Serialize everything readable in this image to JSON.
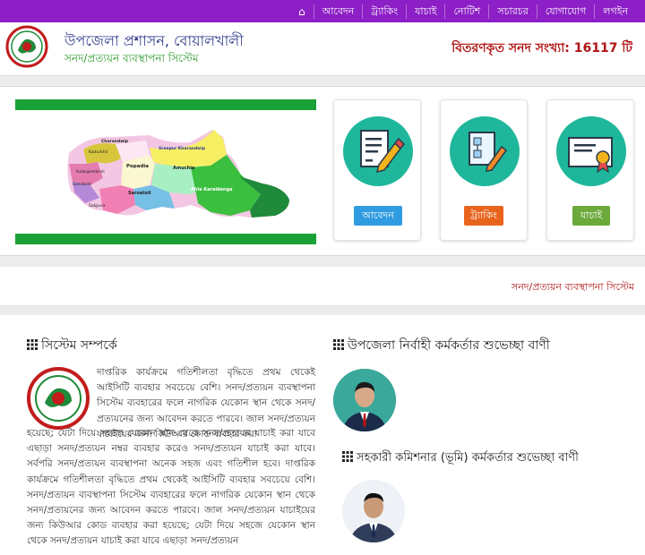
{
  "nav": {
    "items": [
      "আবেদন",
      "ট্র্যাকিং",
      "যাচাই",
      "নোটিশ",
      "সচারচর",
      "যোগাযোগ",
      "লগইন"
    ]
  },
  "header": {
    "org_name": "উপজেলা প্রশাসন, বোয়ালখালী",
    "system_name": "সনদ/প্রত্যয়ন ব্যবস্থাপনা সিস্টেম",
    "issued_label": "বিতরণকৃত সনদ সংখ্যা:",
    "issued_count": "16117",
    "issued_unit": "টি"
  },
  "map": {
    "regions": [
      "Charandwip",
      "Sreepur Kharandwip",
      "Kadurkhil",
      "Popadia",
      "Purbogomdondi",
      "Amuchia",
      "Gomdondi",
      "Saroatoli",
      "Ahla Karaldenga",
      "Sakpura"
    ]
  },
  "cards": {
    "apply_label": "আবেদন",
    "tracking_label": "ট্র্যাকিং",
    "verify_label": "যাচাই"
  },
  "marquee": {
    "text": "সনদ/প্রত্যয়ন ব্যবস্থাপনা সিস্টেম"
  },
  "about": {
    "title": "সিস্টেম সম্পর্কে",
    "text_part1": "দাপ্তরিক কার্যক্রমে গতিশীলতা বৃদ্ধিতে প্রথম থেকেই আইসিটি ব্যবহার সবচেয়ে বেশি। সনদ/প্রত্যয়ন ব্যবস্থাপনা সিস্টেম ব্যবহারের ফলে নাগরিক যেকোন স্থান থেকে সনদ/প্রত্যয়নের জন্য আবেদন করতে পারবে। জাল সনদ/প্রত্যয়ন যাচাইয়ের জন্য কিউআর কোড ব্যবহার করা",
    "text_part2": "হয়েছে; যেটা দিয়ে সহজে যেকোন স্থান থেকে সনদ/প্রত্যয়ন যাচাই করা যাবে এছাড়া সনদ/প্রত্যয়ন নম্বর ব্যবহার করেও সনদ/প্রত্যয়ন যাচাই করা যাবে। সর্বপরি সনদ/প্রত্যয়ন ব্যবস্থাপনা অনেক সহজ এবং গতিশীল হবে। দাপ্তরিক কার্যক্রমে গতিশীলতা বৃদ্ধিতে প্রথম থেকেই আইসিটি ব্যবহার সবচেয়ে বেশি। সনদ/প্রত্যয়ন ব্যবস্থাপনা সিস্টেম ব্যবহারের ফলে নাগরিক যেকোন স্থান থেকে সনদ/প্রত্যয়নের জন্য আবেদন করতে পারবে। জাল সনদ/প্রত্যয়ন যাচাইয়ের জন্য কিউআর কোড ব্যবহার করা হয়েছে; যেটা দিয়ে সহজে যেকোন স্থান থেকে সনদ/প্রত্যয়ন যাচাই করা যাবে এছাড়া সনদ/প্রত্যয়ন"
  },
  "messages": {
    "uno_title": "উপজেলা নির্বাহী কর্মকর্তার শুভেচ্ছা বাণী",
    "ac_land_title": "সহকারী কমিশনার (ভূমি) কর্মকর্তার শুভেচ্ছা বাণী"
  },
  "colors": {
    "nav_bg": "#8c1fc5",
    "apply_btn": "#2f9be0",
    "tracking_btn": "#e8641d",
    "verify_btn": "#6aa93a",
    "accent_red": "#b01414"
  }
}
